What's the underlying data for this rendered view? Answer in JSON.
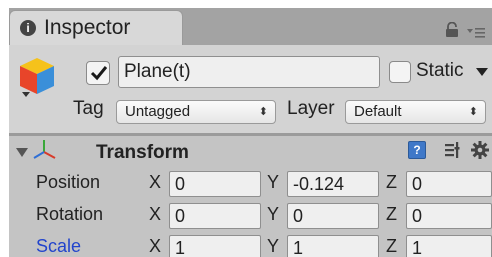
{
  "window": {
    "tab_label": "Inspector",
    "tab_icon": "info-icon",
    "tab_icon_glyph": "i"
  },
  "object": {
    "active": true,
    "name": "Plane(t)",
    "static_label": "Static",
    "static_checked": false,
    "tag_label": "Tag",
    "tag_value": "Untagged",
    "layer_label": "Layer",
    "layer_value": "Default",
    "dropdown_arrows": "⬍"
  },
  "transform": {
    "title": "Transform",
    "help_glyph": "?",
    "rows": [
      {
        "label": "Position",
        "x_label": "X",
        "x": "0",
        "y_label": "Y",
        "y": "-0.124",
        "z_label": "Z",
        "z": "0"
      },
      {
        "label": "Rotation",
        "x_label": "X",
        "x": "0",
        "y_label": "Y",
        "y": "0",
        "z_label": "Z",
        "z": "0"
      },
      {
        "label": "Scale",
        "x_label": "X",
        "x": "1",
        "y_label": "Y",
        "y": "1",
        "z_label": "Z",
        "z": "1"
      }
    ]
  },
  "colors": {
    "scale_label": "#2244cc",
    "help_icon": "#3f78c8",
    "panel_bg": "#c4c4c4"
  }
}
